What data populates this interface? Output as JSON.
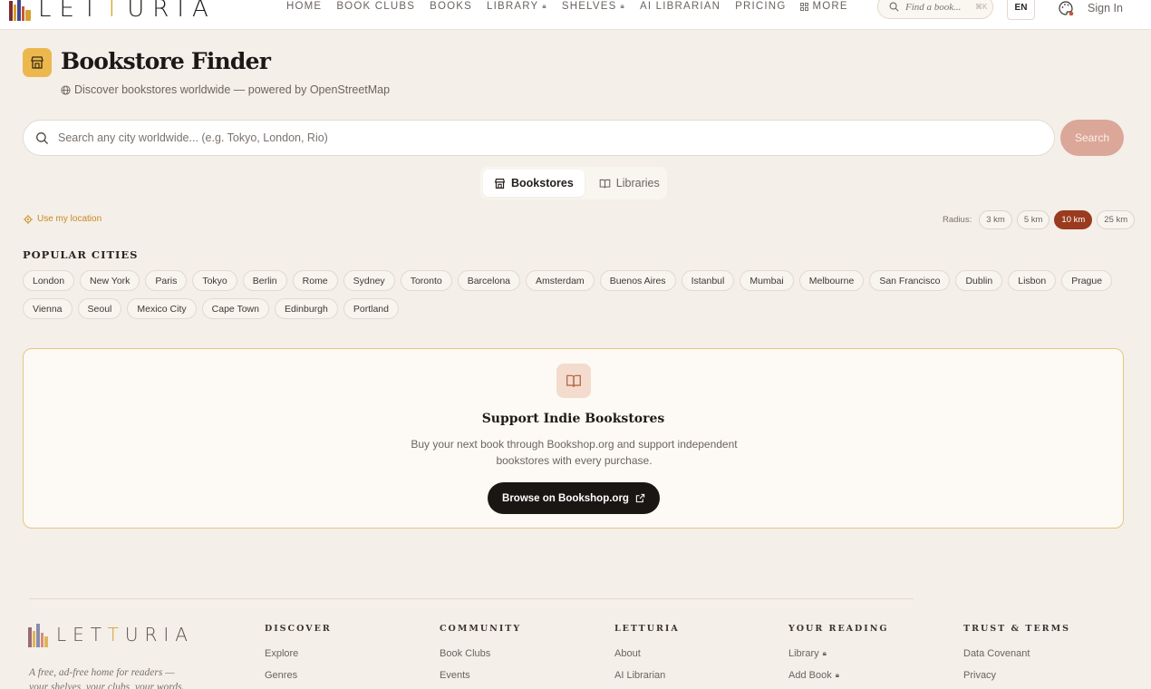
{
  "brand": {
    "name_pre": "LET",
    "name_gold": "T",
    "name_post": "URIA",
    "footer_pre": "LET",
    "footer_gold": "T",
    "footer_post": "URIA"
  },
  "nav": {
    "items": [
      {
        "label": "HOME",
        "locked": false
      },
      {
        "label": "BOOK CLUBS",
        "locked": false
      },
      {
        "label": "BOOKS",
        "locked": false
      },
      {
        "label": "LIBRARY",
        "locked": true
      },
      {
        "label": "SHELVES",
        "locked": true
      },
      {
        "label": "AI LIBRARIAN",
        "locked": false
      },
      {
        "label": "PRICING",
        "locked": false
      },
      {
        "label": "MORE",
        "locked": false
      }
    ],
    "find_placeholder": "Find a book...",
    "find_shortcut": "⌘K",
    "lang": "EN",
    "sign_in": "Sign In"
  },
  "header": {
    "title": "Bookstore Finder",
    "subtitle": "Discover bookstores worldwide — powered by OpenStreetMap"
  },
  "search": {
    "placeholder": "Search any city worldwide... (e.g. Tokyo, London, Rio)",
    "value": "",
    "button": "Search"
  },
  "tabs": [
    {
      "label": "Bookstores",
      "active": true
    },
    {
      "label": "Libraries",
      "active": false
    }
  ],
  "location": {
    "use_my_location": "Use my location"
  },
  "radius": {
    "label": "Radius:",
    "options": [
      "3 km",
      "5 km",
      "10 km",
      "25 km"
    ],
    "selected": "10 km"
  },
  "popular": {
    "heading": "POPULAR CITIES",
    "cities": [
      "London",
      "New York",
      "Paris",
      "Tokyo",
      "Berlin",
      "Rome",
      "Sydney",
      "Toronto",
      "Barcelona",
      "Amsterdam",
      "Buenos Aires",
      "Istanbul",
      "Mumbai",
      "Melbourne",
      "San Francisco",
      "Dublin",
      "Lisbon",
      "Prague",
      "Vienna",
      "Seoul",
      "Mexico City",
      "Cape Town",
      "Edinburgh",
      "Portland"
    ]
  },
  "support": {
    "title": "Support Indie Bookstores",
    "text": "Buy your next book through Bookshop.org and support independent bookstores with every purchase.",
    "button": "Browse on Bookshop.org"
  },
  "footer": {
    "tagline": "A free, ad-free home for readers — your shelves, your clubs, your words.",
    "columns": [
      {
        "heading": "DISCOVER",
        "links": [
          {
            "label": "Explore",
            "locked": false
          },
          {
            "label": "Genres",
            "locked": false
          }
        ]
      },
      {
        "heading": "COMMUNITY",
        "links": [
          {
            "label": "Book Clubs",
            "locked": false
          },
          {
            "label": "Events",
            "locked": false
          }
        ]
      },
      {
        "heading": "LETTURIA",
        "links": [
          {
            "label": "About",
            "locked": false
          },
          {
            "label": "AI Librarian",
            "locked": false
          }
        ]
      },
      {
        "heading": "YOUR READING",
        "links": [
          {
            "label": "Library",
            "locked": true
          },
          {
            "label": "Add Book",
            "locked": true
          }
        ]
      },
      {
        "heading": "TRUST & TERMS",
        "links": [
          {
            "label": "Data Covenant",
            "locked": false
          },
          {
            "label": "Privacy",
            "locked": false
          }
        ]
      }
    ]
  },
  "colors": {
    "accent": "#9a3b1f",
    "gold": "#ecb84e",
    "search_button": "#dba799",
    "card_border": "#e8c582"
  }
}
